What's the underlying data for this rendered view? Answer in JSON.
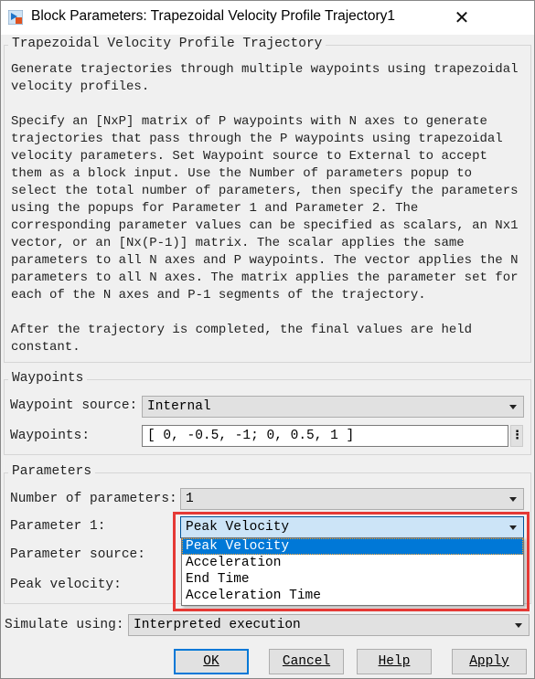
{
  "window": {
    "title": "Block Parameters: Trapezoidal Velocity Profile Trajectory1",
    "icon": "simulink-block-icon",
    "close_icon": "close-icon"
  },
  "description": {
    "group_title": "Trapezoidal Velocity Profile Trajectory",
    "paragraphs": [
      "Generate trajectories through multiple waypoints using trapezoidal\nvelocity profiles.",
      "Specify an [NxP] matrix of P waypoints with N axes to generate\ntrajectories that pass through the P waypoints using trapezoidal\nvelocity parameters. Set Waypoint source to External to accept\nthem as a block input. Use the Number of parameters popup to\nselect the total number of parameters, then specify the parameters\nusing the popups for Parameter 1 and Parameter 2. The\ncorresponding parameter values can be specified as scalars, an Nx1\nvector, or an [Nx(P-1)] matrix. The scalar applies the same\nparameters to all N axes and P waypoints. The vector applies the N\nparameters to all N axes. The matrix applies the parameter set for\neach of the N axes and P-1 segments of the trajectory.",
      "After the trajectory is completed, the final values are held\nconstant."
    ]
  },
  "waypoints": {
    "group_title": "Waypoints",
    "source_label": "Waypoint source:",
    "source_value": "Internal",
    "waypoints_label": "Waypoints:",
    "waypoints_value": "[ 0, -0.5, -1; 0, 0.5, 1 ]"
  },
  "parameters": {
    "group_title": "Parameters",
    "num_label": "Number of parameters:",
    "num_value": "1",
    "param1_label": "Parameter 1:",
    "param1_value": "Peak Velocity",
    "source_label": "Parameter source:",
    "peak_label": "Peak velocity:",
    "param1_options": [
      "Peak Velocity",
      "Acceleration",
      "End Time",
      "Acceleration Time"
    ],
    "highlight_color": "#e53935"
  },
  "simulate": {
    "label": "Simulate using:",
    "value": "Interpreted execution"
  },
  "buttons": {
    "ok": "OK",
    "cancel": "Cancel",
    "help": "Help",
    "apply": "Apply"
  },
  "colors": {
    "selection": "#0078d7",
    "focus_border": "#0078d7",
    "annotation_box": "#e53935"
  }
}
